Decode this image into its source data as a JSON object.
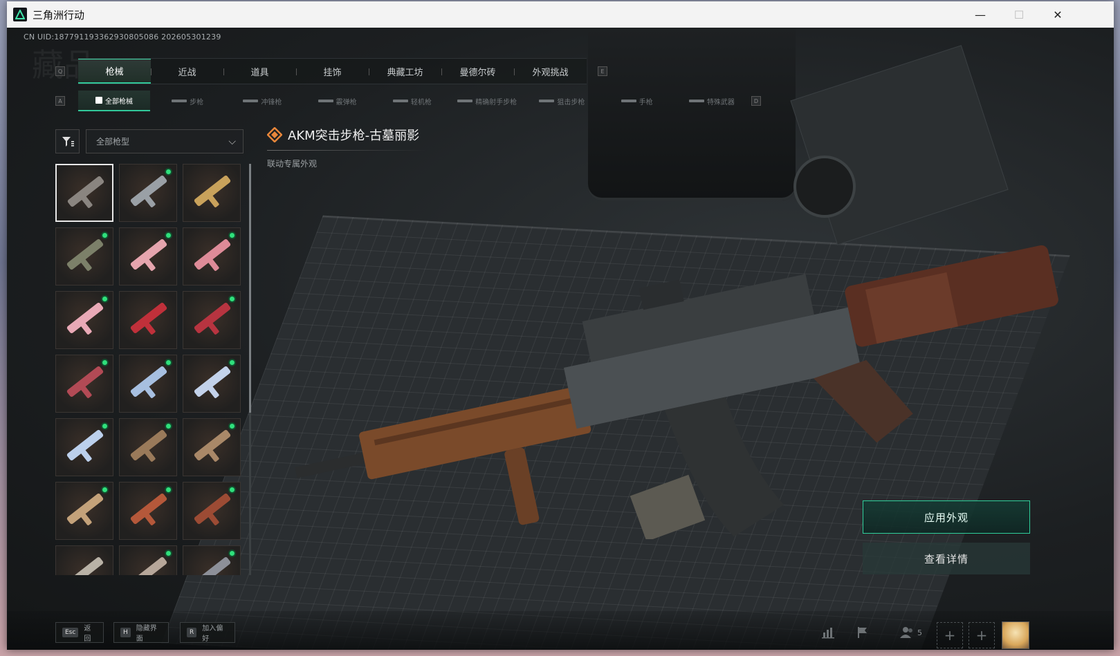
{
  "window": {
    "title": "三角洲行动",
    "minimize_glyph": "—",
    "maximize_glyph": "☐",
    "close_glyph": "✕"
  },
  "header": {
    "uid": "CN UID:187791193362930805086 202605301239",
    "watermark": "藏品"
  },
  "tabs": [
    {
      "label": "枪械",
      "active": true
    },
    {
      "label": "近战",
      "active": false
    },
    {
      "label": "道具",
      "active": false
    },
    {
      "label": "挂饰",
      "active": false
    },
    {
      "label": "典藏工坊",
      "active": false
    },
    {
      "label": "曼德尔砖",
      "active": false
    },
    {
      "label": "外观挑战",
      "active": false
    }
  ],
  "tab_keys": {
    "left": "Q",
    "right": "E"
  },
  "subtabs": [
    {
      "label": "全部枪械",
      "active": true
    },
    {
      "label": "步枪",
      "active": false
    },
    {
      "label": "冲锋枪",
      "active": false
    },
    {
      "label": "霰弹枪",
      "active": false
    },
    {
      "label": "轻机枪",
      "active": false
    },
    {
      "label": "精确射手步枪",
      "active": false
    },
    {
      "label": "狙击步枪",
      "active": false
    },
    {
      "label": "手枪",
      "active": false
    },
    {
      "label": "特殊武器",
      "active": false
    }
  ],
  "subtab_keys": {
    "left": "A",
    "right": "D"
  },
  "filter": {
    "icon": "filter-icon",
    "select_value": "全部枪型"
  },
  "items": [
    {
      "color": "#8a8580",
      "new": false,
      "selected": true
    },
    {
      "color": "#9aa0a6",
      "new": true
    },
    {
      "color": "#c9a25b",
      "new": false
    },
    {
      "color": "#7c8069",
      "new": true
    },
    {
      "color": "#e6a5ae",
      "new": true
    },
    {
      "color": "#de8b98",
      "new": true
    },
    {
      "color": "#e9a9b6",
      "new": true
    },
    {
      "color": "#c0303a",
      "new": false
    },
    {
      "color": "#b73440",
      "new": true
    },
    {
      "color": "#b24a55",
      "new": true
    },
    {
      "color": "#a7bfe0",
      "new": true
    },
    {
      "color": "#c3d2ea",
      "new": true
    },
    {
      "color": "#bcd0ec",
      "new": true
    },
    {
      "color": "#9a7a5a",
      "new": true
    },
    {
      "color": "#a98868",
      "new": true
    },
    {
      "color": "#c4a27a",
      "new": true
    },
    {
      "color": "#b5583a",
      "new": true
    },
    {
      "color": "#9c4b34",
      "new": true
    },
    {
      "color": "#b9b2a6",
      "new": false
    },
    {
      "color": "#b7a79a",
      "new": true
    },
    {
      "color": "#8d9099",
      "new": true
    }
  ],
  "selected_item": {
    "name": "AKM突击步枪-古墓丽影",
    "subtitle": "联动专属外观",
    "rarity_color": "#e8863a"
  },
  "actions": {
    "apply": "应用外观",
    "details": "查看详情"
  },
  "bottom_hints": [
    {
      "key": "Esc",
      "label": "返回"
    },
    {
      "key": "H",
      "label": "隐藏界面"
    },
    {
      "key": "R",
      "label": "加入偏好"
    }
  ],
  "bottom_right": {
    "stats_icon": "bar-chart-icon",
    "flag_icon": "flag-icon",
    "friends_icon": "friends-icon",
    "friends_count": "5",
    "plus_glyph": "+"
  },
  "colors": {
    "accent": "#31c89a",
    "new_dot": "#2fe07c"
  }
}
